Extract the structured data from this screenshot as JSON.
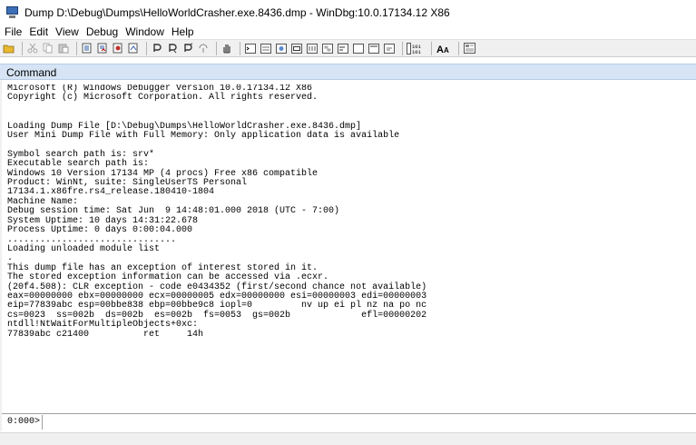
{
  "window": {
    "title": "Dump D:\\Debug\\Dumps\\HelloWorldCrasher.exe.8436.dmp - WinDbg:10.0.17134.12 X86"
  },
  "menu": [
    "File",
    "Edit",
    "View",
    "Debug",
    "Window",
    "Help"
  ],
  "toolbar": {
    "groups": [
      [
        "open-icon"
      ],
      [
        "cut-icon",
        "copy-icon",
        "paste-icon"
      ],
      [
        "step-into-icon",
        "step-over-icon",
        "break-icon",
        "restart-icon"
      ],
      [
        "go-icon",
        "step-icon",
        "step-out-icon",
        "run-to-cursor-icon"
      ],
      [
        "hand-icon"
      ],
      [
        "command-window-icon",
        "watch-window-icon",
        "locals-window-icon",
        "registers-window-icon",
        "memory-window-icon",
        "call-stack-window-icon",
        "disassembly-window-icon",
        "scratch-pad-window-icon",
        "processes-threads-icon",
        "source-mode-icon"
      ],
      [
        "hex-mode-icon"
      ],
      [
        "font-icon"
      ],
      [
        "options-icon"
      ]
    ],
    "binary_label": "101\n101",
    "font_label": "AA"
  },
  "command_window": {
    "title": "Command",
    "output": "Microsoft (R) Windows Debugger Version 10.0.17134.12 X86\nCopyright (c) Microsoft Corporation. All rights reserved.\n\n\nLoading Dump File [D:\\Debug\\Dumps\\HelloWorldCrasher.exe.8436.dmp]\nUser Mini Dump File with Full Memory: Only application data is available\n\nSymbol search path is: srv*\nExecutable search path is:\nWindows 10 Version 17134 MP (4 procs) Free x86 compatible\nProduct: WinNt, suite: SingleUserTS Personal\n17134.1.x86fre.rs4_release.180410-1804\nMachine Name:\nDebug session time: Sat Jun  9 14:48:01.000 2018 (UTC - 7:00)\nSystem Uptime: 10 days 14:31:22.678\nProcess Uptime: 0 days 0:00:04.000\n...............................\nLoading unloaded module list\n.\nThis dump file has an exception of interest stored in it.\nThe stored exception information can be accessed via .ecxr.\n(20f4.508): CLR exception - code e0434352 (first/second chance not available)\neax=00000000 ebx=00000000 ecx=00000005 edx=00000000 esi=00000003 edi=00000003\neip=77839abc esp=00bbe838 ebp=00bbe9c8 iopl=0         nv up ei pl nz na po nc\ncs=0023  ss=002b  ds=002b  es=002b  fs=0053  gs=002b             efl=00000202\nntdll!NtWaitForMultipleObjects+0xc:\n77839abc c21400          ret     14h",
    "prompt": "0:000>",
    "input_value": ""
  }
}
